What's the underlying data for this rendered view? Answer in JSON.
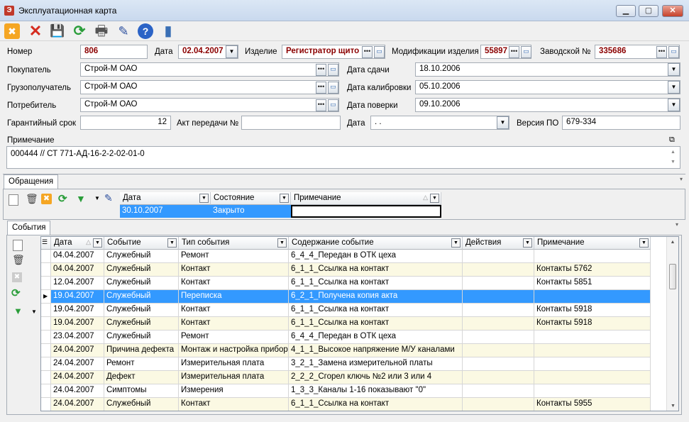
{
  "window": {
    "title": "Эксплуатационная карта",
    "minimize": "▁",
    "maximize": "▢",
    "close": "✕"
  },
  "toolbar": {
    "cancel": "✖",
    "delete": "✕",
    "save": "💾",
    "refresh": "⟳",
    "print": "🖶",
    "edit": "✎",
    "help": "?",
    "exit": "▮"
  },
  "form": {
    "number_label": "Номер",
    "number_value": "806",
    "date_label": "Дата",
    "date_value": "02.04.2007",
    "product_label": "Изделие",
    "product_value": "Регистратор щито",
    "modifications_label": "Модификации изделия",
    "modifications_value": "55897",
    "serial_label": "Заводской №",
    "serial_value": "335686",
    "buyer_label": "Покупатель",
    "buyer_value": "Строй-М   ОАО",
    "consignee_label": "Грузополучатель",
    "consignee_value": "Строй-М   ОАО",
    "consumer_label": "Потребитель",
    "consumer_value": "Строй-М   ОАО",
    "handover_date_label": "Дата сдачи",
    "handover_date_value": "18.10.2006",
    "calibration_date_label": "Дата калибровки",
    "calibration_date_value": "05.10.2006",
    "verification_date_label": "Дата поверки",
    "verification_date_value": "09.10.2006",
    "warranty_label": "Гарантийный срок",
    "warranty_value": "12",
    "transfer_act_label": "Акт передачи №",
    "transfer_act_value": "",
    "date2_label": "Дата",
    "date2_value": "  .  .",
    "software_version_label": "Версия ПО",
    "software_version_value": "679-334",
    "note_label": "Примечание",
    "note_value": "000444 // СТ 771-АД-16-2-2-02-01-0"
  },
  "appeals": {
    "tab": "Обращения",
    "columns": [
      "Дата",
      "Состояние",
      "Примечание"
    ],
    "rows": [
      [
        "30.10.2007",
        "Закрыто",
        ""
      ]
    ]
  },
  "events": {
    "tab": "События",
    "columns": [
      "Дата",
      "Событие",
      "Тип события",
      "Содержание событие",
      "Действия",
      "Примечание"
    ],
    "selected_index": 3,
    "rows": [
      [
        "04.04.2007",
        "Служебный",
        "Ремонт",
        "6_4_4_Передан в ОТК цеха",
        "",
        ""
      ],
      [
        "04.04.2007",
        "Служебный",
        "Контакт",
        "6_1_1_Ссылка на контакт",
        "",
        "Контакты 5762"
      ],
      [
        "12.04.2007",
        "Служебный",
        "Контакт",
        "6_1_1_Ссылка на контакт",
        "",
        "Контакты 5851"
      ],
      [
        "19.04.2007",
        "Служебный",
        "Переписка",
        "6_2_1_Получена копия акта",
        "",
        ""
      ],
      [
        "19.04.2007",
        "Служебный",
        "Контакт",
        "6_1_1_Ссылка на контакт",
        "",
        "Контакты 5918"
      ],
      [
        "19.04.2007",
        "Служебный",
        "Контакт",
        "6_1_1_Ссылка на контакт",
        "",
        "Контакты 5918"
      ],
      [
        "23.04.2007",
        "Служебный",
        "Ремонт",
        "6_4_4_Передан в ОТК цеха",
        "",
        ""
      ],
      [
        "24.04.2007",
        "Причина дефекта",
        "Монтаж и настройка прибора",
        "4_1_1_Высокое напряжение М/У каналами",
        "",
        ""
      ],
      [
        "24.04.2007",
        "Ремонт",
        "Измерительная плата",
        "3_2_1_Замена измерительной платы",
        "",
        ""
      ],
      [
        "24.04.2007",
        "Дефект",
        "Измерительная плата",
        "2_2_2_Сгорел ключь №2 или 3 или 4",
        "",
        ""
      ],
      [
        "24.04.2007",
        "Симптомы",
        "Измерения",
        "1_3_3_Каналы 1-16 показывают \"0\"",
        "",
        ""
      ],
      [
        "24.04.2007",
        "Служебный",
        "Контакт",
        "6_1_1_Ссылка на контакт",
        "",
        "Контакты 5955"
      ]
    ]
  }
}
